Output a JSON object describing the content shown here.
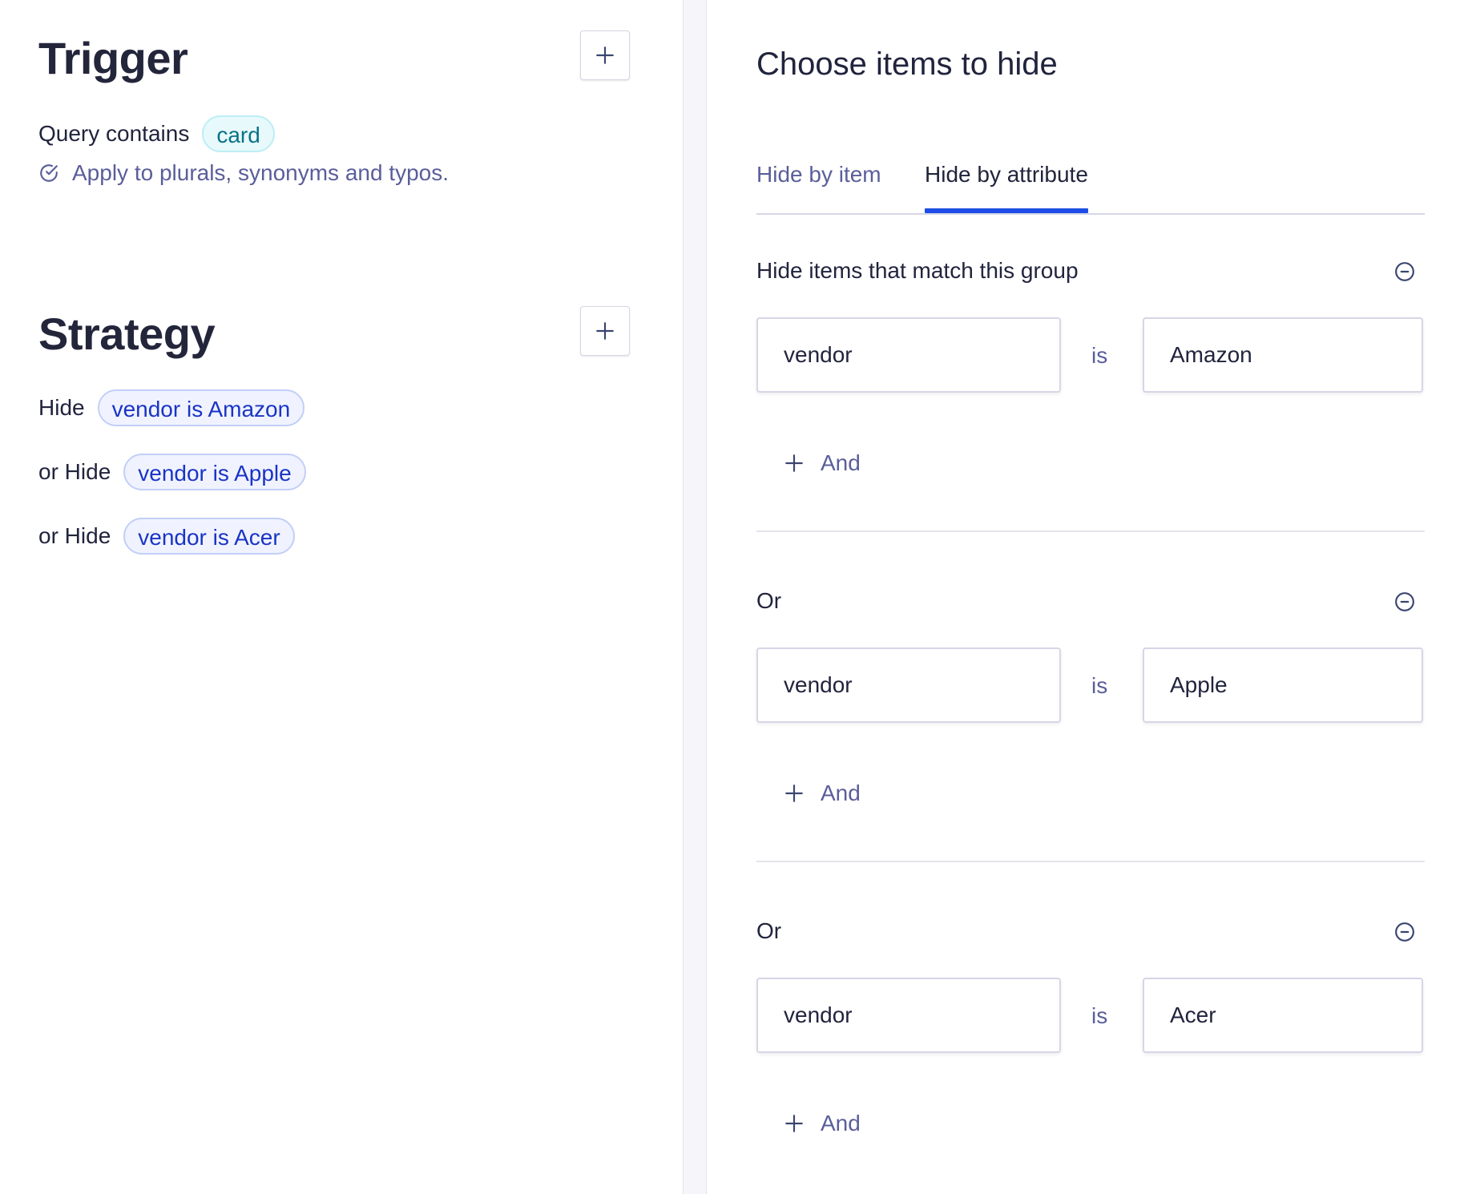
{
  "trigger": {
    "title": "Trigger",
    "query_label": "Query contains",
    "query_chip": "card",
    "hint": "Apply to plurals, synonyms and typos."
  },
  "strategy": {
    "title": "Strategy",
    "rows": [
      {
        "prefix": "Hide",
        "chip": "vendor is Amazon"
      },
      {
        "prefix": "or Hide",
        "chip": "vendor is Apple"
      },
      {
        "prefix": "or Hide",
        "chip": "vendor is Acer"
      }
    ]
  },
  "panel": {
    "title": "Choose items to hide",
    "tabs": [
      "Hide by item",
      "Hide by attribute"
    ],
    "active_tab": "Hide by attribute",
    "groups": [
      {
        "label": "Hide items that match this group",
        "attribute": "vendor",
        "operator": "is",
        "value": "Amazon",
        "and_label": "And"
      },
      {
        "label": "Or",
        "attribute": "vendor",
        "operator": "is",
        "value": "Apple",
        "and_label": "And"
      },
      {
        "label": "Or",
        "attribute": "vendor",
        "operator": "is",
        "value": "Acer",
        "and_label": "And"
      }
    ]
  },
  "icons": {
    "add": "plus-icon",
    "check": "check-circle-icon",
    "remove": "minus-circle-icon"
  },
  "colors": {
    "accent": "#1d4de6",
    "teal_chip_text": "#0a7385",
    "blue_chip_text": "#1a34c4",
    "muted_text": "#5a5e9a"
  }
}
